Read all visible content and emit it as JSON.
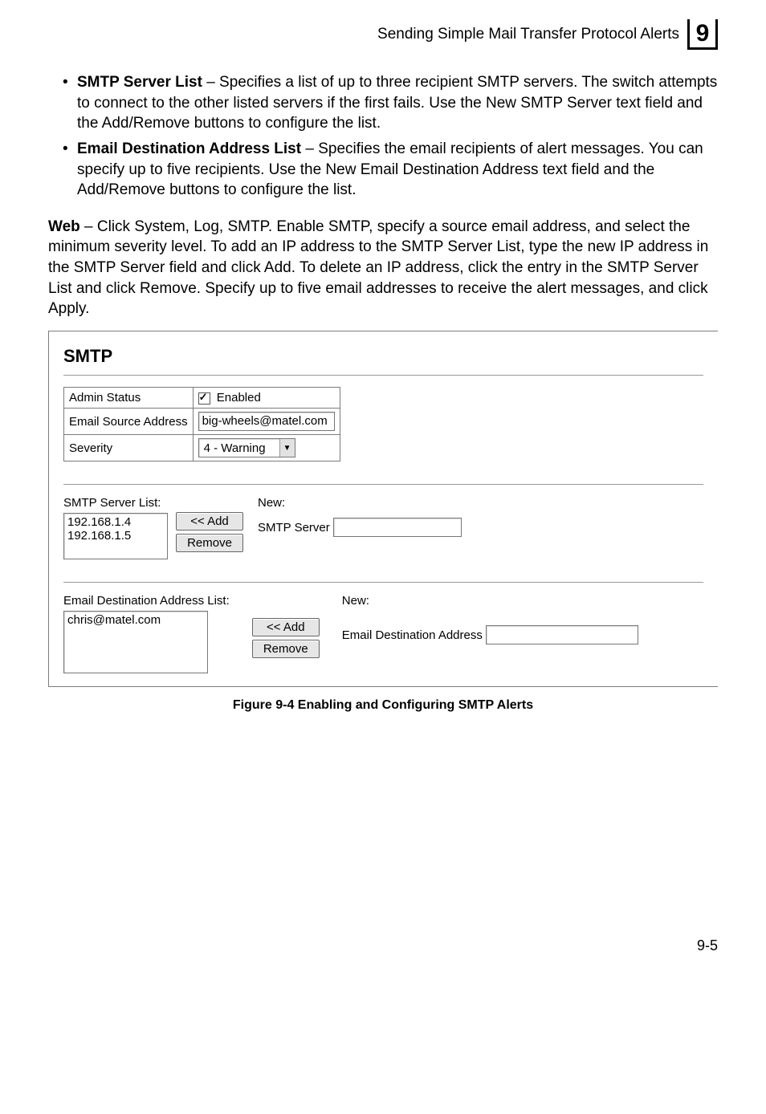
{
  "header": {
    "title": "Sending Simple Mail Transfer Protocol Alerts",
    "chapter": "9"
  },
  "bullets": [
    {
      "term": "SMTP Server List",
      "rest": " – Specifies a list of up to three recipient SMTP servers. The switch attempts to connect to the other listed servers if the first fails. Use the New SMTP Server text field and the Add/Remove buttons to configure the list."
    },
    {
      "term": "Email Destination Address List",
      "rest": " – Specifies the email recipients of alert messages. You can specify up to five recipients. Use the New Email Destination Address text field and the Add/Remove buttons to configure the list."
    }
  ],
  "web_para": {
    "term": "Web",
    "rest": " – Click System, Log, SMTP. Enable SMTP, specify a source email address, and select the minimum severity level. To add an IP address to the SMTP Server List, type the new IP address in the SMTP Server field and click Add. To delete an IP address, click the entry in the SMTP Server List and click Remove. Specify up to five email addresses to receive the alert messages, and click Apply."
  },
  "panel": {
    "title": "SMTP",
    "rows": {
      "admin_status_label": "Admin Status",
      "admin_status_value": "Enabled",
      "email_source_label": "Email Source Address",
      "email_source_value": "big-wheels@matel.com",
      "severity_label": "Severity",
      "severity_value": "4 - Warning"
    },
    "smtp_list": {
      "label": "SMTP Server List:",
      "items": [
        "192.168.1.4",
        "192.168.1.5"
      ],
      "add_btn": "<< Add",
      "remove_btn": "Remove",
      "new_label": "New:",
      "input_label": "SMTP Server",
      "input_value": ""
    },
    "email_list": {
      "label": "Email Destination Address List:",
      "items": [
        "chris@matel.com"
      ],
      "add_btn": "<< Add",
      "remove_btn": "Remove",
      "new_label": "New:",
      "input_label": "Email Destination Address",
      "input_value": ""
    }
  },
  "caption": "Figure 9-4  Enabling and Configuring SMTP Alerts",
  "page_num": "9-5"
}
